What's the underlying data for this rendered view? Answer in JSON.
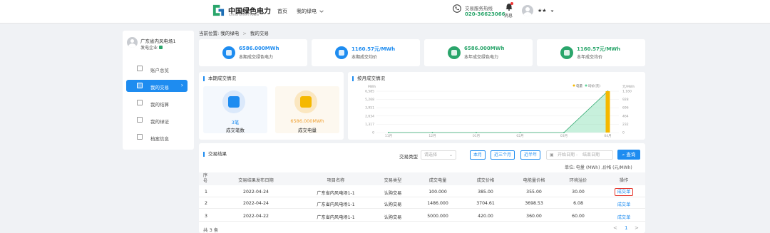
{
  "header": {
    "logo_cn": "中国绿色电力",
    "logo_en": "China Green Power",
    "nav_home": "首页",
    "nav_my_green": "我的绿电",
    "hotline_label": "交易服务热线",
    "hotline_number": "020-36623066",
    "messages_label": "消息",
    "username": "★★",
    "brand_color": "#2aa56b"
  },
  "sidebar": {
    "company_name": "广东省内风电场1",
    "role": "发电企业",
    "items": [
      {
        "label": "账户总览",
        "icon": "account-overview-icon"
      },
      {
        "label": "我的交易",
        "icon": "my-trades-icon"
      },
      {
        "label": "我的结算",
        "icon": "my-settlement-icon"
      },
      {
        "label": "我的绿证",
        "icon": "green-certificate-icon"
      },
      {
        "label": "档案信息",
        "icon": "archive-info-icon"
      }
    ],
    "active_index": 1,
    "active_color": "#1e8cf0"
  },
  "breadcrumb": {
    "prefix": "当前位置:",
    "level1": "我的绿电",
    "sep": ">",
    "level2": "我的交易"
  },
  "stats": [
    {
      "value": "6586.000MWh",
      "label": "本期成交绿色电力",
      "color": "#1e8cf0"
    },
    {
      "value": "1160.57元/MWh",
      "label": "本期成交均价",
      "color": "#1e8cf0"
    },
    {
      "value": "6586.000MWh",
      "label": "本年成交绿色电力",
      "color": "#2aa56b"
    },
    {
      "value": "1160.57元/MWh",
      "label": "本年成交均价",
      "color": "#2aa56b"
    }
  ],
  "current_period": {
    "title": "本期成交情况",
    "count_value": "3笔",
    "count_label": "成交笔数",
    "energy_value": "6586.000MWh",
    "energy_label": "成交电量"
  },
  "monthly": {
    "title": "按月成交情况"
  },
  "chart_data": {
    "type": "bar",
    "title": "按月成交情况",
    "categories": [
      "11月",
      "12月",
      "01月",
      "02月",
      "03月",
      "04月"
    ],
    "series": [
      {
        "name": "电量",
        "type": "area",
        "axis": "left",
        "values": [
          0,
          0,
          0,
          0,
          0,
          6586
        ],
        "color": "#5fd39a"
      },
      {
        "name": "均价(元)",
        "type": "bar",
        "axis": "right",
        "values": [
          0,
          0,
          0,
          0,
          0,
          1160.57
        ],
        "color": "#f5b800"
      }
    ],
    "ylabel_left": "MWh",
    "ylabel_right": "元/MWh",
    "yticks_left": [
      "6,585",
      "5,268",
      "3,951",
      "2,634",
      "1,317",
      "0"
    ],
    "yticks_right": [
      "1,160",
      "928",
      "696",
      "464",
      "232",
      "0"
    ],
    "ylim_left": [
      0,
      6585
    ],
    "ylim_right": [
      0,
      1160
    ],
    "legend": "top-right",
    "grid": true
  },
  "results": {
    "title": "交易结果",
    "trade_type_label": "交易类型",
    "trade_type_placeholder": "请选择",
    "btn_month": "本月",
    "btn_three_months": "近三个月",
    "btn_half_year": "近半年",
    "date_start_placeholder": "开始日期",
    "date_sep": "-",
    "date_end_placeholder": "结束日期",
    "query_label": "查询",
    "unit_note": "单位: 电量 (MWh) ,价格 (元/MWh)",
    "columns": [
      "序号",
      "交易结果发布日期",
      "项目名称",
      "交易类型",
      "成交电量",
      "成交价格",
      "电能量价格",
      "环境溢价",
      "操作"
    ],
    "rows": [
      {
        "no": "1",
        "date": "2022-04-24",
        "project": "广东省内风电场1-1",
        "type": "认购交易",
        "energy": "100.000",
        "price": "385.00",
        "energy_price": "355.00",
        "premium": "30.00",
        "action": "成交单"
      },
      {
        "no": "2",
        "date": "2022-04-24",
        "project": "广东省内风电场1-1",
        "type": "认购交易",
        "energy": "1486.000",
        "price": "3704.61",
        "energy_price": "3698.53",
        "premium": "6.08",
        "action": "成交单"
      },
      {
        "no": "3",
        "date": "2022-04-22",
        "project": "广东省内风电场1-1",
        "type": "认购交易",
        "energy": "5000.000",
        "price": "420.00",
        "energy_price": "360.00",
        "premium": "60.00",
        "action": "成交单"
      }
    ],
    "total_label": "共 3 条",
    "page_prev": "<",
    "page_current": "1",
    "page_next": ">"
  }
}
